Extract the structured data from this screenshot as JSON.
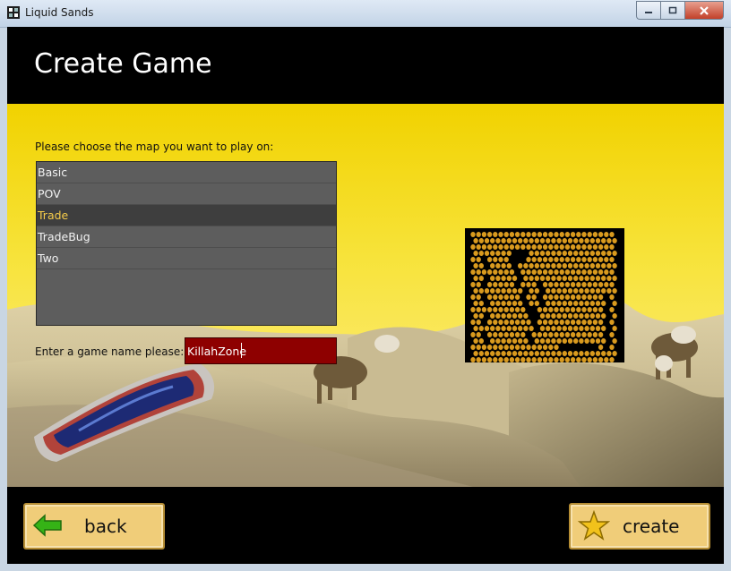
{
  "window": {
    "title": "Liquid Sands"
  },
  "header": {
    "title": "Create Game"
  },
  "map_select": {
    "prompt": "Please choose the map you want to play on:",
    "items": [
      "Basic",
      "POV",
      "Trade",
      "TradeBug",
      "Two"
    ],
    "selected": "Trade"
  },
  "game_name": {
    "label": "Enter a game name please:",
    "value": "KillahZone"
  },
  "buttons": {
    "back": "back",
    "create": "create"
  },
  "colors": {
    "sky": "#f1d200",
    "list_bg": "#5d5d5d",
    "selected_text": "#f6cc4a",
    "input_bg": "#8e0000",
    "button_bg": "#f0cd79",
    "map_dot": "#d99a1e"
  },
  "icons": {
    "back": "green-left-arrow-icon",
    "create": "gold-star-icon"
  }
}
